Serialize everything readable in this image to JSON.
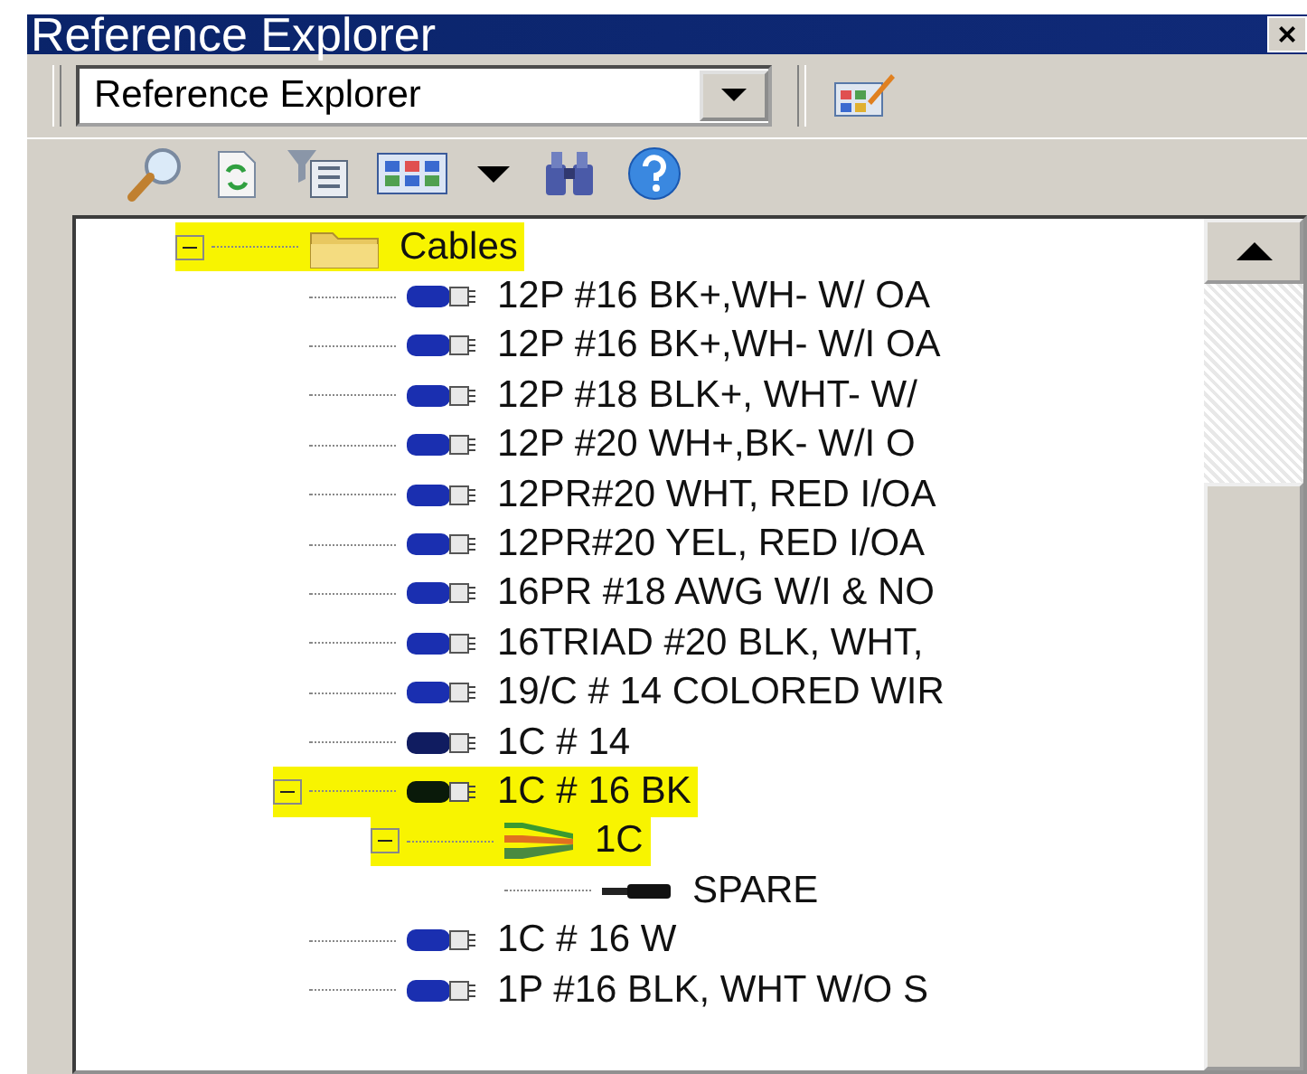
{
  "window": {
    "title": "Reference Explorer",
    "close": "×"
  },
  "view_selector": {
    "value": "Reference Explorer"
  },
  "tree": {
    "items": [
      {
        "label": "Cables",
        "kind": "folder",
        "expanded": true,
        "highlighted": true,
        "children": [
          {
            "label": "12P #16 BK+,WH- W/ OA",
            "kind": "cable",
            "color": "#1a2fb0",
            "highlighted": false
          },
          {
            "label": "12P #16 BK+,WH- W/I OA",
            "kind": "cable",
            "color": "#1a2fb0",
            "highlighted": false
          },
          {
            "label": "12P #18 BLK+, WHT-  W/",
            "kind": "cable",
            "color": "#1a2fb0",
            "highlighted": false
          },
          {
            "label": "12P #20 WH+,BK-  W/I O",
            "kind": "cable",
            "color": "#1a2fb0",
            "highlighted": false
          },
          {
            "label": "12PR#20 WHT, RED I/OA",
            "kind": "cable",
            "color": "#1a2fb0",
            "highlighted": false
          },
          {
            "label": "12PR#20 YEL, RED I/OA",
            "kind": "cable",
            "color": "#1a2fb0",
            "highlighted": false
          },
          {
            "label": "16PR #18 AWG W/I & NO",
            "kind": "cable",
            "color": "#1a2fb0",
            "highlighted": false
          },
          {
            "label": "16TRIAD #20 BLK, WHT,",
            "kind": "cable",
            "color": "#1a2fb0",
            "highlighted": false
          },
          {
            "label": "19/C # 14 COLORED WIR",
            "kind": "cable",
            "color": "#1a2fb0",
            "highlighted": false
          },
          {
            "label": "1C # 14",
            "kind": "cable",
            "color": "#101c60",
            "highlighted": false
          },
          {
            "label": "1C # 16 BK",
            "kind": "cable",
            "color": "#0a1a0a",
            "expanded": true,
            "highlighted": true,
            "children": [
              {
                "label": "1C",
                "kind": "bundle",
                "expanded": true,
                "highlighted": true,
                "children": [
                  {
                    "label": "SPARE",
                    "kind": "wire",
                    "highlighted": false
                  }
                ]
              }
            ]
          },
          {
            "label": "1C # 16 W",
            "kind": "cable",
            "color": "#1a2fb0",
            "highlighted": false
          },
          {
            "label": "1P #16 BLK, WHT W/O S",
            "kind": "cable",
            "color": "#1a2fb0",
            "highlighted": false
          }
        ]
      }
    ]
  }
}
